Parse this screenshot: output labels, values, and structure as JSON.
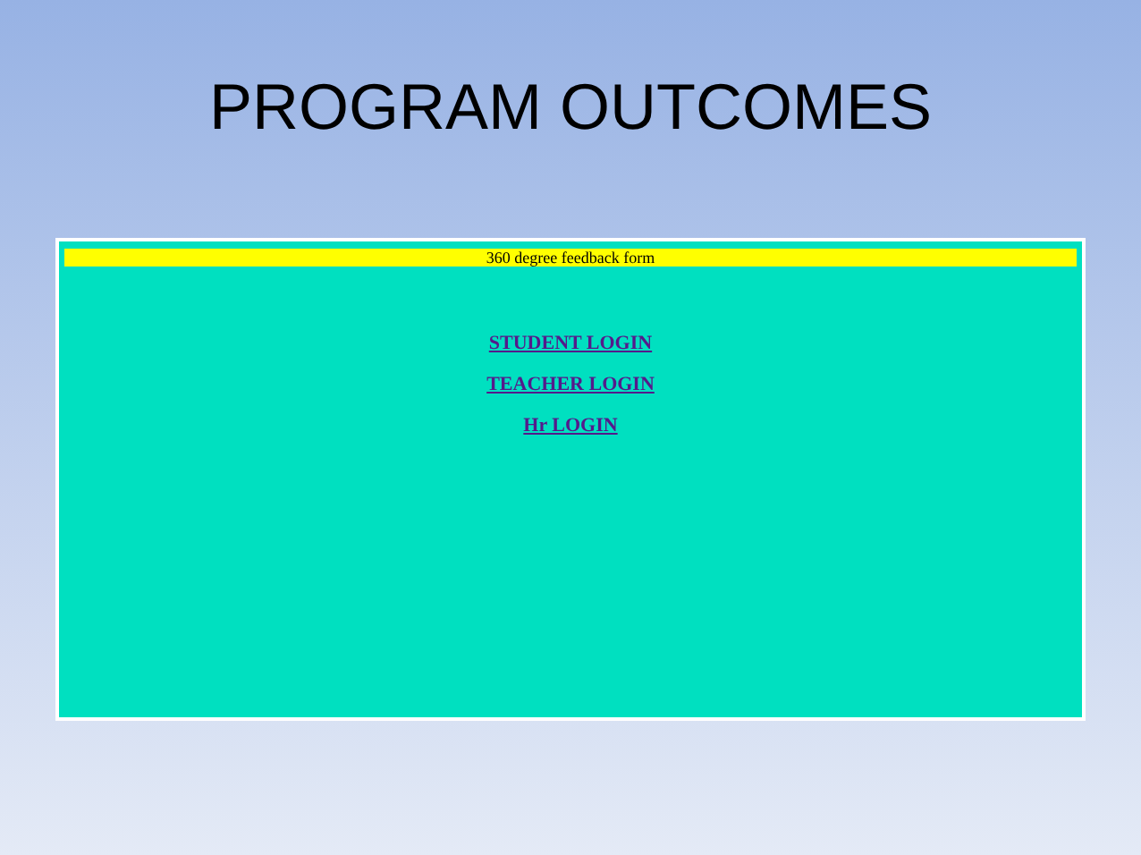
{
  "slide": {
    "title": "PROGRAM OUTCOMES"
  },
  "web_page": {
    "header": "360 degree feedback form",
    "links": [
      "STUDENT LOGIN",
      "TEACHER LOGIN",
      "Hr LOGIN"
    ]
  }
}
